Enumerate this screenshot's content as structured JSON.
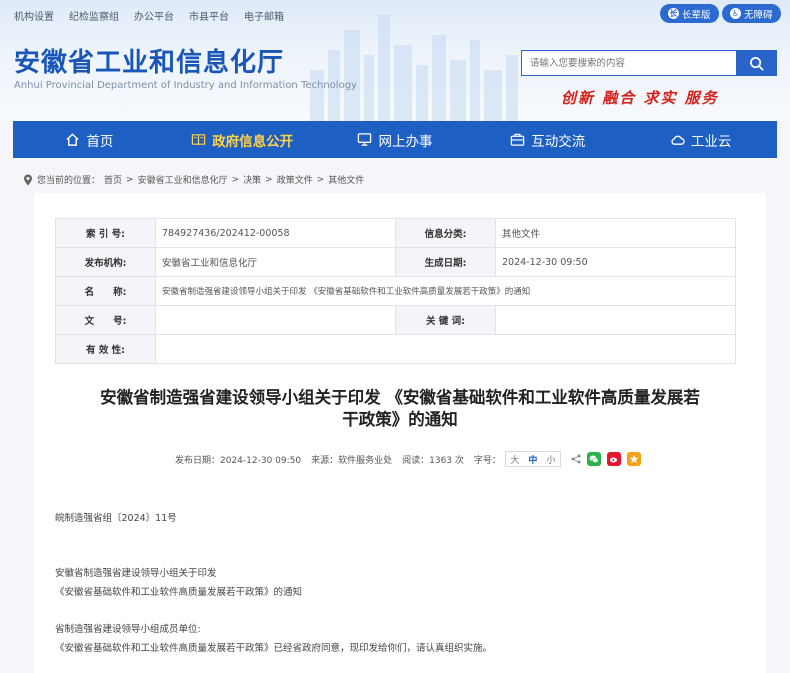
{
  "top_links": [
    "机构设置",
    "纪检监察组",
    "办公平台",
    "市县平台",
    "电子邮箱"
  ],
  "accessibility": {
    "elder": "长辈版",
    "barrier_free": "无障碍"
  },
  "site": {
    "title_cn": "安徽省工业和信息化厅",
    "title_en": "Anhui Provincial Department of Industry and Information Technology",
    "slogan": "创新 融合 求实 服务"
  },
  "search": {
    "placeholder": "请输入您要搜索的内容"
  },
  "nav": [
    {
      "label": "首页",
      "icon": "home-icon"
    },
    {
      "label": "政府信息公开",
      "icon": "book-icon",
      "active": true
    },
    {
      "label": "网上办事",
      "icon": "monitor-icon"
    },
    {
      "label": "互动交流",
      "icon": "briefcase-icon"
    },
    {
      "label": "工业云",
      "icon": "cloud-icon"
    }
  ],
  "breadcrumb": {
    "prefix": "您当前的位置：",
    "items": [
      "首页",
      "安徽省工业和信息化厅",
      "决策",
      "政策文件",
      "其他文件"
    ]
  },
  "info_table": {
    "index_label": "索 引 号:",
    "index_value": "784927436/202412-00058",
    "category_label": "信息分类:",
    "category_value": "其他文件",
    "publisher_label": "发布机构:",
    "publisher_value": "安徽省工业和信息化厅",
    "date_label": "生成日期:",
    "date_value": "2024-12-30 09:50",
    "name_label": "名　　称:",
    "name_value": "安徽省制造强省建设领导小组关于印发 《安徽省基础软件和工业软件高质量发展若干政策》的通知",
    "docno_label": "文　　号:",
    "docno_value": "",
    "keywords_label": "关 键 词:",
    "keywords_value": "",
    "validity_label": "有 效 性:",
    "validity_value": ""
  },
  "article": {
    "title_line1": "安徽省制造强省建设领导小组关于印发 《安徽省基础软件和工业软件高质量发展若",
    "title_line2": "干政策》的通知",
    "publish": "发布日期：2024-12-30 09:50",
    "source": "来源：软件服务业处",
    "views": "阅读：1363 次",
    "fontsize_label": "字号：",
    "font_sizes": [
      "大",
      "中",
      "小"
    ],
    "paragraphs": [
      "皖制造强省组〔2024〕11号",
      "安徽省制造强省建设领导小组关于印发",
      "《安徽省基础软件和工业软件高质量发展若干政策》的通知",
      "省制造强省建设领导小组成员单位:",
      "《安徽省基础软件和工业软件高质量发展若干政策》已经省政府同意，现印发给你们，请认真组织实施。"
    ]
  },
  "colors": {
    "brand_blue": "#1d5fc2",
    "active_nav": "#ffd24a",
    "slogan_red": "#d2231c"
  }
}
